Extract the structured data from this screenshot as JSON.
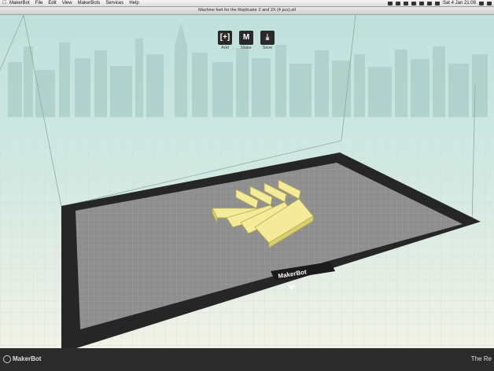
{
  "menubar": {
    "apple_icon": "apple-icon",
    "menus": [
      "MakerBot",
      "File",
      "Edit",
      "View",
      "MakerBots",
      "Services",
      "Help"
    ],
    "clock": "Sat 4 Jan  21:08",
    "status_icons": [
      "dropbox-icon",
      "sync-icon",
      "bluetooth-icon",
      "wifi-icon",
      "volume-icon",
      "battery-icon",
      "flag-icon",
      "search-icon",
      "list-icon"
    ]
  },
  "window": {
    "title": "Machine feet for the Replicator 2 and 2X (4 pcs).stl"
  },
  "toolbar": {
    "add_label": "Add",
    "add_glyph": "[+]",
    "make_label": "Make",
    "make_glyph": "M",
    "save_label": "Save",
    "save_glyph": "⤓"
  },
  "build_plate": {
    "brand_text": "MakerBot"
  },
  "bottom_bar": {
    "logo_text": "MakerBot",
    "right_text": "The Re"
  },
  "colors": {
    "sky": "#cfe6e2",
    "plate_border": "#262626",
    "plate_surface": "#8f8f8f",
    "model": "#f3eb9a",
    "model_outline": "#b7ac47"
  }
}
